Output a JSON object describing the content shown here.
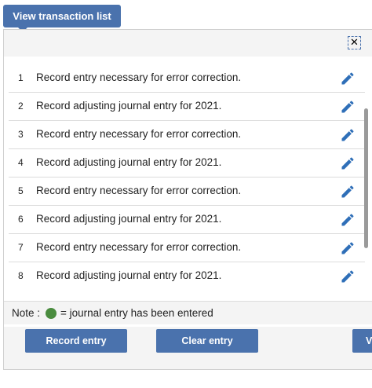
{
  "header": {
    "view_transaction_list_label": "View transaction list"
  },
  "dialog": {
    "close_symbol": "✕"
  },
  "entries": [
    {
      "num": "1",
      "text": "Record entry necessary for error correction."
    },
    {
      "num": "2",
      "text": "Record adjusting journal entry for 2021."
    },
    {
      "num": "3",
      "text": "Record entry necessary for error correction."
    },
    {
      "num": "4",
      "text": "Record adjusting journal entry for 2021."
    },
    {
      "num": "5",
      "text": "Record entry necessary for error correction."
    },
    {
      "num": "6",
      "text": "Record adjusting journal entry for 2021."
    },
    {
      "num": "7",
      "text": "Record entry necessary for error correction."
    },
    {
      "num": "8",
      "text": "Record adjusting journal entry for 2021."
    }
  ],
  "note": {
    "label": "Note :",
    "text": "= journal entry has been entered",
    "dot_color": "#4a8c3f"
  },
  "buttons": {
    "record_entry": "Record entry",
    "clear_entry": "Clear entry",
    "view_partial": "V"
  },
  "colors": {
    "accent": "#4a72ad",
    "edit_icon": "#2f6fb8"
  }
}
